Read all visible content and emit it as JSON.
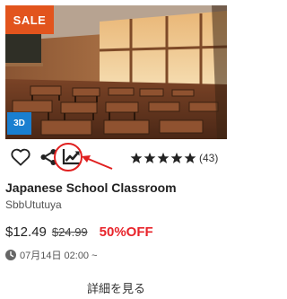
{
  "product": {
    "sale_label": "SALE",
    "badge_3d": "3D",
    "title": "Japanese School Classroom",
    "author": "SbbUtutuya",
    "price_current": "$12.49",
    "price_original": "$24.99",
    "discount": "50%OFF",
    "rating_stars": 5,
    "rating_count": "(43)",
    "date": "07月14日 02:00 ~",
    "details_label": "詳細を見る"
  },
  "icons": {
    "like": "heart-icon",
    "share": "share-icon",
    "stats": "trending-chart-icon",
    "date": "clock-icon"
  },
  "colors": {
    "sale": "#e2541d",
    "badge_3d": "#1a7fd0",
    "discount": "#e8232a",
    "annotation": "#e02020",
    "star": "#222222"
  }
}
